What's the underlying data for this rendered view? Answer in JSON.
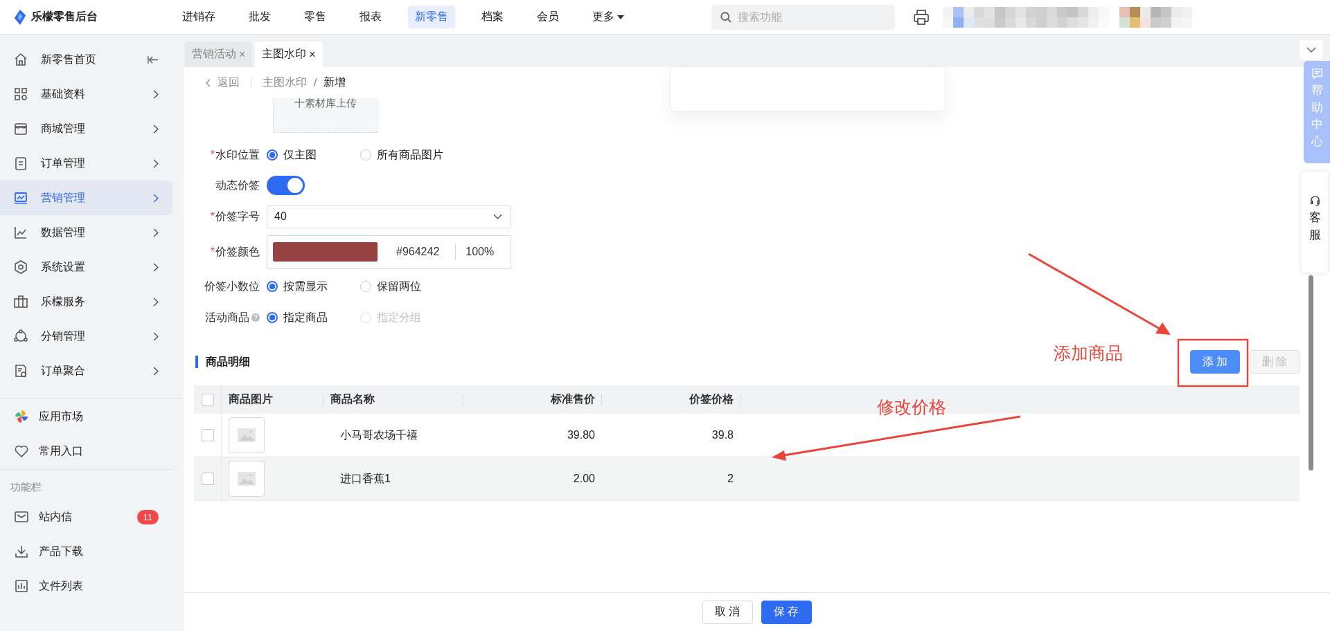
{
  "app": {
    "title": "乐檬零售后台"
  },
  "top_nav": [
    {
      "label": "进销存",
      "selected": false
    },
    {
      "label": "批发",
      "selected": false
    },
    {
      "label": "零售",
      "selected": false
    },
    {
      "label": "报表",
      "selected": false
    },
    {
      "label": "新零售",
      "selected": true
    },
    {
      "label": "档案",
      "selected": false
    },
    {
      "label": "会员",
      "selected": false
    },
    {
      "label": "更多",
      "selected": false,
      "kind": "dropdown"
    }
  ],
  "search": {
    "placeholder": "搜索功能"
  },
  "sidebar": {
    "items": [
      {
        "label": "新零售首页",
        "kind": "home",
        "selected": false
      },
      {
        "label": "基础资料",
        "kind": "group",
        "selected": false
      },
      {
        "label": "商城管理",
        "kind": "group",
        "selected": false
      },
      {
        "label": "订单管理",
        "kind": "group",
        "selected": false
      },
      {
        "label": "营销管理",
        "kind": "group",
        "selected": true
      },
      {
        "label": "数据管理",
        "kind": "group",
        "selected": false
      },
      {
        "label": "系统设置",
        "kind": "group",
        "selected": false
      },
      {
        "label": "乐檬服务",
        "kind": "group",
        "selected": false
      },
      {
        "label": "分销管理",
        "kind": "group",
        "selected": false
      },
      {
        "label": "订单聚合",
        "kind": "group",
        "selected": false
      }
    ],
    "extras": [
      {
        "label": "应用市场"
      },
      {
        "label": "常用入口"
      }
    ],
    "section_title": "功能栏",
    "tools": [
      {
        "label": "站内信",
        "badge": "11"
      },
      {
        "label": "产品下载"
      },
      {
        "label": "文件列表"
      }
    ]
  },
  "tabs": [
    {
      "label": "营销活动",
      "close": "×",
      "selected": false
    },
    {
      "label": "主图水印",
      "close": "×",
      "selected": true
    }
  ],
  "breadcrumb": {
    "back": "返回",
    "items": [
      "主图水印",
      "新增"
    ],
    "separator": "/"
  },
  "upload": {
    "label": "十素材库上传"
  },
  "form": [
    {
      "kind": "radio",
      "label": "水印位置",
      "mark": "*",
      "options": [
        {
          "label": "仅主图",
          "selected": true,
          "disabled": false
        },
        {
          "label": "所有商品图片",
          "selected": false,
          "disabled": false
        }
      ]
    },
    {
      "kind": "switch",
      "label": "动态价签",
      "on": true
    },
    {
      "kind": "select",
      "label": "价签字号",
      "mark": "*",
      "value": "40"
    },
    {
      "kind": "color",
      "label": "价签颜色",
      "mark": "*",
      "color": "#964242",
      "value": "#964242",
      "opacity": "100%"
    },
    {
      "kind": "radio",
      "label": "价签小数位",
      "options": [
        {
          "label": "按需显示",
          "selected": true,
          "disabled": false
        },
        {
          "label": "保留两位",
          "selected": false,
          "disabled": false
        }
      ]
    },
    {
      "kind": "radio",
      "label": "活动商品",
      "help": true,
      "options": [
        {
          "label": "指定商品",
          "selected": true,
          "disabled": false
        },
        {
          "label": "指定分组",
          "selected": false,
          "disabled": true
        }
      ]
    }
  ],
  "section": {
    "title": "商品明细"
  },
  "actions": [
    {
      "label": "添 加",
      "kind": "primary",
      "disabled": false
    },
    {
      "label": "删 除",
      "kind": "default",
      "disabled": true
    }
  ],
  "table": {
    "columns": [
      "商品图片",
      "商品名称",
      "标准售价",
      "价签价格"
    ],
    "all_checked": false,
    "rows": [
      {
        "checked": false,
        "name": "小马哥农场千禧",
        "price": "39.80",
        "tag_price": "39.8",
        "hovered": false
      },
      {
        "checked": false,
        "name": "进口香蕉1",
        "price": "2.00",
        "tag_price": "2",
        "hovered": true
      }
    ]
  },
  "annotations": [
    {
      "text": "添加商品"
    },
    {
      "text": "修改价格"
    }
  ],
  "footer": [
    {
      "label": "取 消",
      "kind": "default"
    },
    {
      "label": "保 存",
      "kind": "primary"
    }
  ],
  "float_tabs": [
    {
      "label": "帮助中心",
      "kind": "help"
    },
    {
      "label": "客服",
      "kind": "service"
    }
  ]
}
